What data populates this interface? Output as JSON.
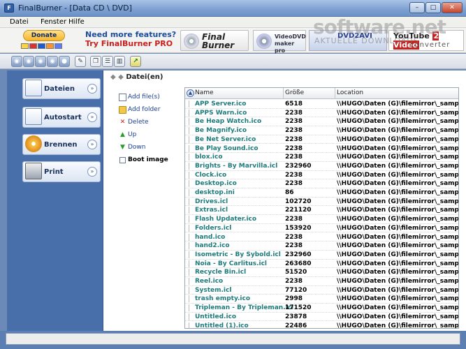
{
  "window": {
    "title": "FinalBurner - [Data CD \\ DVD]",
    "controls": {
      "minimize": "–",
      "maximize": "□",
      "close": "✕"
    }
  },
  "menu": [
    "Datei",
    "Fenster",
    "Hilfe"
  ],
  "banner": {
    "donate_label": "Donate",
    "ad_line1": "Need more features?",
    "ad_line2": "Try FinalBurner PRO",
    "logo_finalburner": "Final Burner",
    "logo_videodvd": "VideoDVD maker pro",
    "logo_dvd2avi": "DVD2AVI",
    "logo_youtube_prefix": "YouTube",
    "logo_youtube_suffix": "2 Video",
    "logo_youtube_sub": "converter"
  },
  "watermark": {
    "main": "software.net",
    "sub": "AKTUELLE DOWNLOADS"
  },
  "sidebar": {
    "items": [
      {
        "label": "Dateien",
        "icon": "files-icon"
      },
      {
        "label": "Autostart",
        "icon": "autostart-icon"
      },
      {
        "label": "Brennen",
        "icon": "burn-disc-icon"
      },
      {
        "label": "Print",
        "icon": "printer-icon"
      }
    ]
  },
  "main": {
    "breadcrumb": "Datei(en)",
    "actions": {
      "add_files": "Add file(s)",
      "add_folder": "Add folder",
      "delete": "Delete",
      "up": "Up",
      "down": "Down",
      "boot_image": "Boot image"
    },
    "table": {
      "headers": [
        "Name",
        "Größe",
        "Location"
      ],
      "rows": [
        {
          "name": "APP Server.ico",
          "size": "6518",
          "location": "\\\\HUGO\\Daten (G)\\filemirror\\_samples\\"
        },
        {
          "name": "APPS Warn.ico",
          "size": "2238",
          "location": "\\\\HUGO\\Daten (G)\\filemirror\\_samples\\"
        },
        {
          "name": "Be Heap Watch.ico",
          "size": "2238",
          "location": "\\\\HUGO\\Daten (G)\\filemirror\\_samples\\"
        },
        {
          "name": "Be Magnify.ico",
          "size": "2238",
          "location": "\\\\HUGO\\Daten (G)\\filemirror\\_samples\\"
        },
        {
          "name": "Be Net Server.ico",
          "size": "2238",
          "location": "\\\\HUGO\\Daten (G)\\filemirror\\_samples\\"
        },
        {
          "name": "Be Play Sound.ico",
          "size": "2238",
          "location": "\\\\HUGO\\Daten (G)\\filemirror\\_samples\\"
        },
        {
          "name": "blox.ico",
          "size": "2238",
          "location": "\\\\HUGO\\Daten (G)\\filemirror\\_samples\\"
        },
        {
          "name": "Brights - By Marvilla.icl",
          "size": "232960",
          "location": "\\\\HUGO\\Daten (G)\\filemirror\\_samples\\"
        },
        {
          "name": "Clock.ico",
          "size": "2238",
          "location": "\\\\HUGO\\Daten (G)\\filemirror\\_samples\\"
        },
        {
          "name": "Desktop.ico",
          "size": "2238",
          "location": "\\\\HUGO\\Daten (G)\\filemirror\\_samples\\"
        },
        {
          "name": "desktop.ini",
          "size": "86",
          "location": "\\\\HUGO\\Daten (G)\\filemirror\\_samples\\"
        },
        {
          "name": "Drives.icl",
          "size": "102720",
          "location": "\\\\HUGO\\Daten (G)\\filemirror\\_samples\\"
        },
        {
          "name": "Extras.icl",
          "size": "221120",
          "location": "\\\\HUGO\\Daten (G)\\filemirror\\_samples\\"
        },
        {
          "name": "Flash Updater.ico",
          "size": "2238",
          "location": "\\\\HUGO\\Daten (G)\\filemirror\\_samples\\"
        },
        {
          "name": "Folders.icl",
          "size": "153920",
          "location": "\\\\HUGO\\Daten (G)\\filemirror\\_samples\\"
        },
        {
          "name": "hand.ico",
          "size": "2238",
          "location": "\\\\HUGO\\Daten (G)\\filemirror\\_samples\\"
        },
        {
          "name": "hand2.ico",
          "size": "2238",
          "location": "\\\\HUGO\\Daten (G)\\filemirror\\_samples\\"
        },
        {
          "name": "Isometric - By Sybold.icl",
          "size": "232960",
          "location": "\\\\HUGO\\Daten (G)\\filemirror\\_samples\\"
        },
        {
          "name": "Noia - By Carlitus.icl",
          "size": "263680",
          "location": "\\\\HUGO\\Daten (G)\\filemirror\\_samples\\"
        },
        {
          "name": "Recycle Bin.icl",
          "size": "51520",
          "location": "\\\\HUGO\\Daten (G)\\filemirror\\_samples\\"
        },
        {
          "name": "Reel.ico",
          "size": "2238",
          "location": "\\\\HUGO\\Daten (G)\\filemirror\\_samples\\"
        },
        {
          "name": "System.icl",
          "size": "77120",
          "location": "\\\\HUGO\\Daten (G)\\filemirror\\_samples\\"
        },
        {
          "name": "trash empty.ico",
          "size": "2998",
          "location": "\\\\HUGO\\Daten (G)\\filemirror\\_samples\\"
        },
        {
          "name": "Tripleman - By Tripleman.icl",
          "size": "171520",
          "location": "\\\\HUGO\\Daten (G)\\filemirror\\_samples\\"
        },
        {
          "name": "Untitled.ico",
          "size": "23878",
          "location": "\\\\HUGO\\Daten (G)\\filemirror\\_samples\\"
        },
        {
          "name": "Untitled (1).ico",
          "size": "22486",
          "location": "\\\\HUGO\\Daten (G)\\filemirror\\_samples\\"
        }
      ]
    }
  }
}
